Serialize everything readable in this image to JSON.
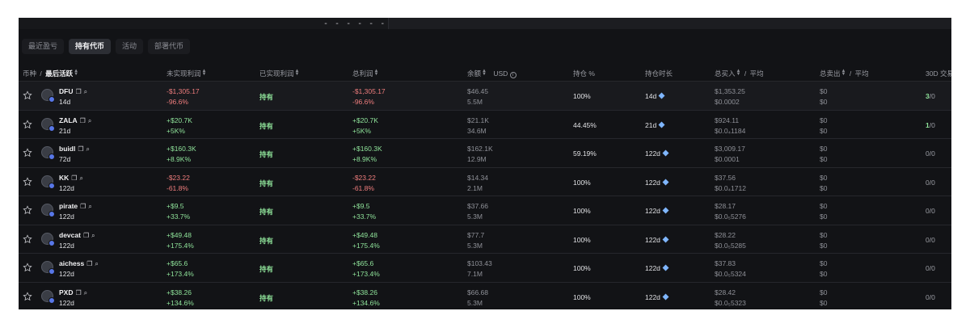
{
  "top": {
    "dashes": "- - - - - - -"
  },
  "tabs": [
    "最近盈亏",
    "持有代币",
    "活动",
    "部署代币"
  ],
  "columns": {
    "token": "币种",
    "sep": "/",
    "last_active": "最后活跃",
    "unrealized": "未实现利润",
    "realized": "已实现利润",
    "total": "总利润",
    "balance": "余额",
    "balance_unit": "USD",
    "holding_pct": "持仓 %",
    "holding_time": "持仓时长",
    "bought": "总买入",
    "bought_avg": "平均",
    "sold": "总卖出",
    "sold_avg": "平均",
    "trades_30d": "30D 交易"
  },
  "rows": [
    {
      "name": "DFU",
      "age": "14d",
      "unreal_usd": "-$1,305.17",
      "unreal_pct": "-96.6%",
      "realized": "持有",
      "total_usd": "-$1,305.17",
      "total_pct": "-96.6%",
      "balance_usd": "$46.45",
      "balance_amt": "5.5M",
      "hold_pct": "100%",
      "hold_time": "14d",
      "buy_usd": "$1,353.25",
      "buy_avg": "$0.0002",
      "sell_usd": "$0",
      "sell_avg": "$0",
      "trades_buy": "3",
      "trades_sell": "/0",
      "sign": "neg"
    },
    {
      "name": "ZALA",
      "age": "21d",
      "unreal_usd": "+$20.7K",
      "unreal_pct": "+5K%",
      "realized": "持有",
      "total_usd": "+$20.7K",
      "total_pct": "+5K%",
      "balance_usd": "$21.1K",
      "balance_amt": "34.6M",
      "hold_pct": "44.45%",
      "hold_time": "21d",
      "buy_usd": "$924.11",
      "buy_avg": "$0.0₄1184",
      "sell_usd": "$0",
      "sell_avg": "$0",
      "trades_buy": "1",
      "trades_sell": "/0",
      "sign": "pos"
    },
    {
      "name": "buidl",
      "age": "72d",
      "unreal_usd": "+$160.3K",
      "unreal_pct": "+8.9K%",
      "realized": "持有",
      "total_usd": "+$160.3K",
      "total_pct": "+8.9K%",
      "balance_usd": "$162.1K",
      "balance_amt": "12.9M",
      "hold_pct": "59.19%",
      "hold_time": "122d",
      "buy_usd": "$3,009.17",
      "buy_avg": "$0.0001",
      "sell_usd": "$0",
      "sell_avg": "$0",
      "trades_buy": "",
      "trades_sell": "0/0",
      "sign": "pos"
    },
    {
      "name": "KK",
      "age": "122d",
      "unreal_usd": "-$23.22",
      "unreal_pct": "-61.8%",
      "realized": "持有",
      "total_usd": "-$23.22",
      "total_pct": "-61.8%",
      "balance_usd": "$14.34",
      "balance_amt": "2.1M",
      "hold_pct": "100%",
      "hold_time": "122d",
      "buy_usd": "$37.56",
      "buy_avg": "$0.0₄1712",
      "sell_usd": "$0",
      "sell_avg": "$0",
      "trades_buy": "",
      "trades_sell": "0/0",
      "sign": "neg"
    },
    {
      "name": "pirate",
      "age": "122d",
      "unreal_usd": "+$9.5",
      "unreal_pct": "+33.7%",
      "realized": "持有",
      "total_usd": "+$9.5",
      "total_pct": "+33.7%",
      "balance_usd": "$37.66",
      "balance_amt": "5.3M",
      "hold_pct": "100%",
      "hold_time": "122d",
      "buy_usd": "$28.17",
      "buy_avg": "$0.0₅5276",
      "sell_usd": "$0",
      "sell_avg": "$0",
      "trades_buy": "",
      "trades_sell": "0/0",
      "sign": "pos"
    },
    {
      "name": "devcat",
      "age": "122d",
      "unreal_usd": "+$49.48",
      "unreal_pct": "+175.4%",
      "realized": "持有",
      "total_usd": "+$49.48",
      "total_pct": "+175.4%",
      "balance_usd": "$77.7",
      "balance_amt": "5.3M",
      "hold_pct": "100%",
      "hold_time": "122d",
      "buy_usd": "$28.22",
      "buy_avg": "$0.0₅5285",
      "sell_usd": "$0",
      "sell_avg": "$0",
      "trades_buy": "",
      "trades_sell": "0/0",
      "sign": "pos"
    },
    {
      "name": "aichess",
      "age": "122d",
      "unreal_usd": "+$65.6",
      "unreal_pct": "+173.4%",
      "realized": "持有",
      "total_usd": "+$65.6",
      "total_pct": "+173.4%",
      "balance_usd": "$103.43",
      "balance_amt": "7.1M",
      "hold_pct": "100%",
      "hold_time": "122d",
      "buy_usd": "$37.83",
      "buy_avg": "$0.0₅5324",
      "sell_usd": "$0",
      "sell_avg": "$0",
      "trades_buy": "",
      "trades_sell": "0/0",
      "sign": "pos"
    },
    {
      "name": "PXD",
      "age": "122d",
      "unreal_usd": "+$38.26",
      "unreal_pct": "+134.6%",
      "realized": "持有",
      "total_usd": "+$38.26",
      "total_pct": "+134.6%",
      "balance_usd": "$66.68",
      "balance_amt": "5.3M",
      "hold_pct": "100%",
      "hold_time": "122d",
      "buy_usd": "$28.42",
      "buy_avg": "$0.0₅5323",
      "sell_usd": "$0",
      "sell_avg": "$0",
      "trades_buy": "",
      "trades_sell": "0/0",
      "sign": "pos"
    }
  ]
}
